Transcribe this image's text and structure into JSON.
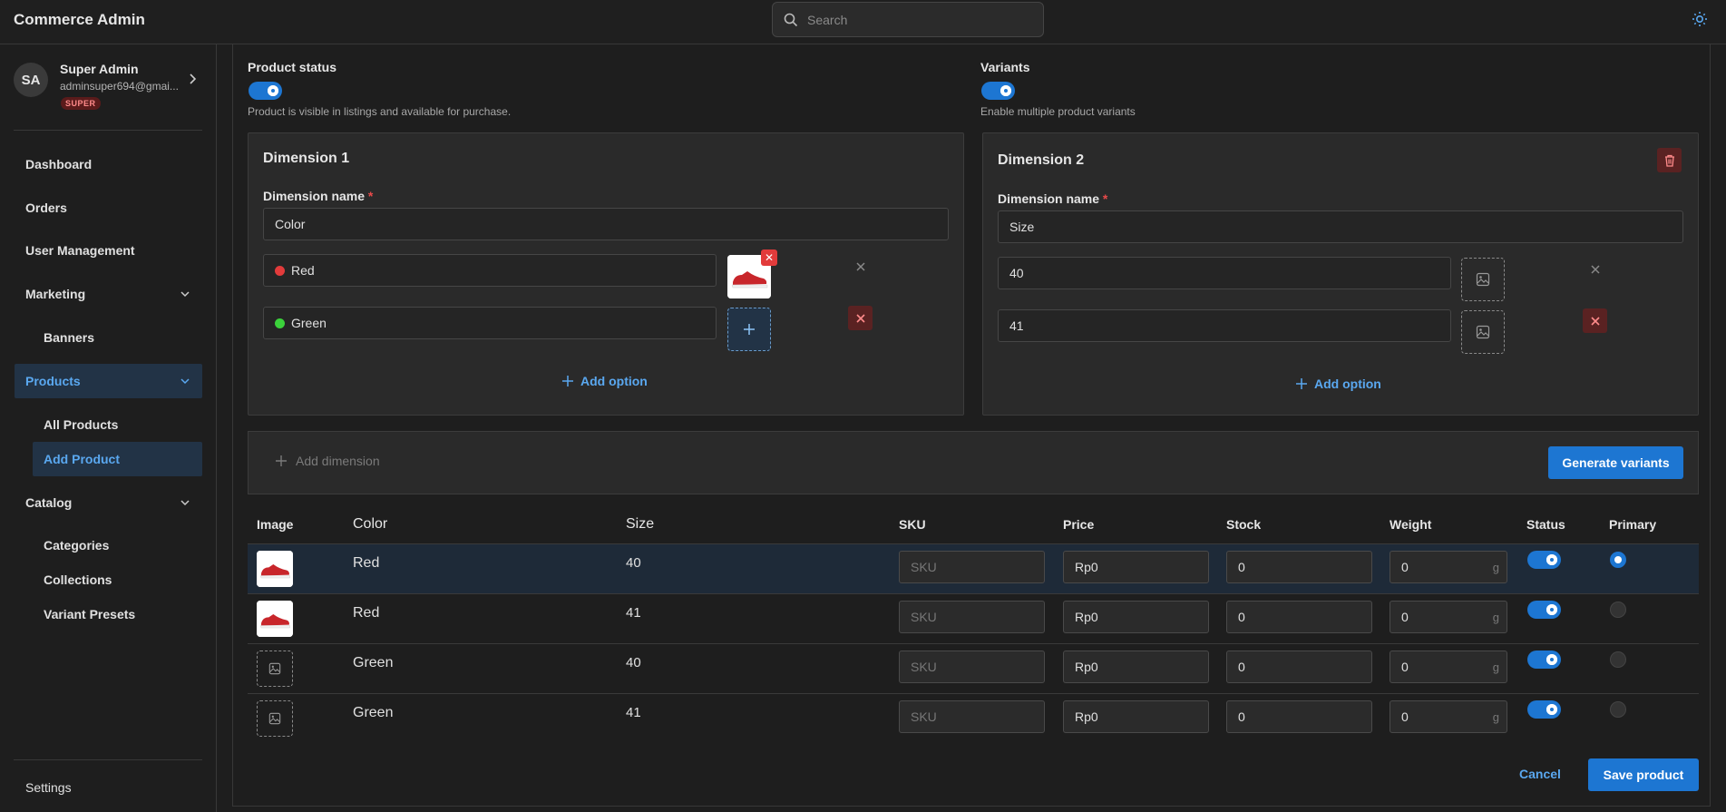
{
  "app": {
    "title": "Commerce Admin"
  },
  "search": {
    "placeholder": "Search"
  },
  "user": {
    "initials": "SA",
    "name": "Super Admin",
    "email": "adminsuper694@gmai...",
    "badge": "SUPER"
  },
  "nav": {
    "dashboard": "Dashboard",
    "orders": "Orders",
    "user_management": "User Management",
    "marketing": "Marketing",
    "banners": "Banners",
    "products": "Products",
    "all_products": "All Products",
    "add_product": "Add Product",
    "catalog": "Catalog",
    "categories": "Categories",
    "collections": "Collections",
    "variant_presets": "Variant Presets",
    "settings": "Settings"
  },
  "status": {
    "label": "Product status",
    "help": "Product is visible in listings and available for purchase.",
    "enabled": true
  },
  "variants": {
    "label": "Variants",
    "help": "Enable multiple product variants",
    "enabled": true
  },
  "dimensions": [
    {
      "title": "Dimension 1",
      "name_label": "Dimension name",
      "name_value": "Color",
      "options": [
        {
          "value": "Red",
          "color": "#e23b3b"
        },
        {
          "value": "Green",
          "color": "#3bd13b"
        }
      ],
      "add_option": "Add option"
    },
    {
      "title": "Dimension 2",
      "name_label": "Dimension name",
      "name_value": "Size",
      "options": [
        {
          "value": "40"
        },
        {
          "value": "41"
        }
      ],
      "add_option": "Add option"
    }
  ],
  "add_dimension": "Add dimension",
  "generate_variants": "Generate variants",
  "table": {
    "headers": {
      "image": "Image",
      "color": "Color",
      "size": "Size",
      "sku": "SKU",
      "price": "Price",
      "stock": "Stock",
      "weight": "Weight",
      "status": "Status",
      "primary": "Primary"
    },
    "rows": [
      {
        "color": "Red",
        "size": "40",
        "sku_placeholder": "SKU",
        "price": "Rp0",
        "stock": "0",
        "weight": "0",
        "weight_unit": "g",
        "has_image": true,
        "primary": true,
        "status": true
      },
      {
        "color": "Red",
        "size": "41",
        "sku_placeholder": "SKU",
        "price": "Rp0",
        "stock": "0",
        "weight": "0",
        "weight_unit": "g",
        "has_image": true,
        "primary": false,
        "status": true
      },
      {
        "color": "Green",
        "size": "40",
        "sku_placeholder": "SKU",
        "price": "Rp0",
        "stock": "0",
        "weight": "0",
        "weight_unit": "g",
        "has_image": false,
        "primary": false,
        "status": true
      },
      {
        "color": "Green",
        "size": "41",
        "sku_placeholder": "SKU",
        "price": "Rp0",
        "stock": "0",
        "weight": "0",
        "weight_unit": "g",
        "has_image": false,
        "primary": false,
        "status": true
      }
    ]
  },
  "actions": {
    "cancel": "Cancel",
    "save": "Save product"
  },
  "colors": {
    "accent": "#1d76d2",
    "link": "#5aa8f0",
    "danger": "#e23b3b"
  }
}
